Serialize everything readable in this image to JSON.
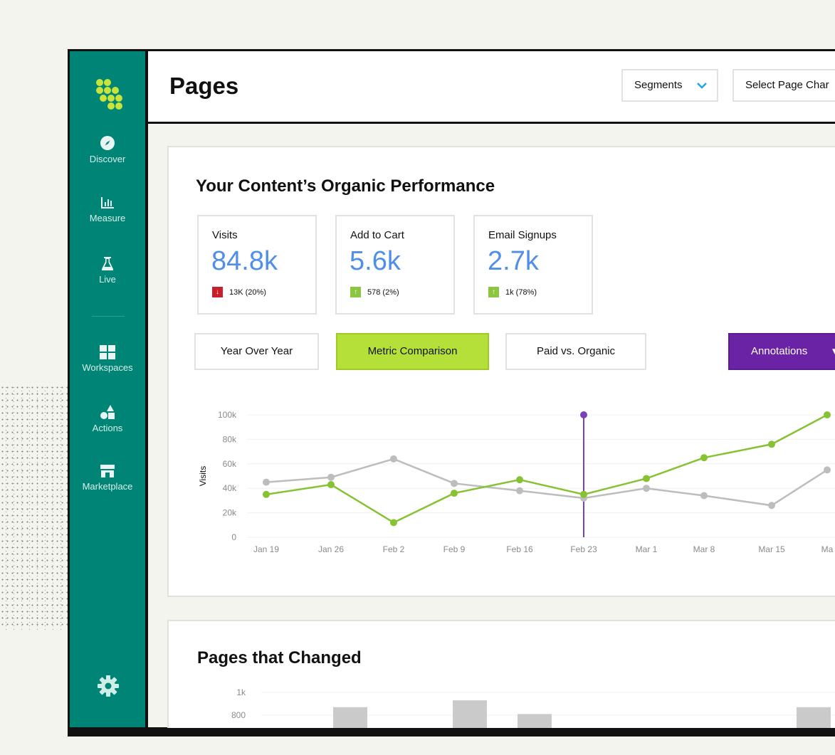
{
  "sidebar": {
    "items": [
      {
        "label": "Discover",
        "icon": "compass-icon"
      },
      {
        "label": "Measure",
        "icon": "bar-chart-icon"
      },
      {
        "label": "Live",
        "icon": "flask-icon"
      },
      {
        "label": "Workspaces",
        "icon": "grid-icon"
      },
      {
        "label": "Actions",
        "icon": "shapes-icon"
      },
      {
        "label": "Marketplace",
        "icon": "storefront-icon"
      }
    ],
    "settings_icon": "gear-icon"
  },
  "header": {
    "title": "Pages",
    "segments_label": "Segments",
    "select_label": "Select Page Char"
  },
  "performance": {
    "title": "Your Content’s Organic Performance",
    "metrics": [
      {
        "label": "Visits",
        "value": "84.8k",
        "delta": "13K (20%)",
        "direction": "down"
      },
      {
        "label": "Add to Cart",
        "value": "5.6k",
        "delta": "578 (2%)",
        "direction": "up"
      },
      {
        "label": "Email Signups",
        "value": "2.7k",
        "delta": "1k (78%)",
        "direction": "up"
      }
    ],
    "tabs": [
      "Year Over Year",
      "Metric Comparison",
      "Paid vs. Organic"
    ],
    "annotations_label": "Annotations"
  },
  "colors": {
    "green": "#86c232",
    "gray": "#bdbdbd",
    "purple": "#7b3fb8",
    "accent_blue": "#4f8fe8"
  },
  "chart_data": [
    {
      "type": "line",
      "ylabel": "Visits",
      "ylim": [
        0,
        100000
      ],
      "yticks": [
        "0",
        "20k",
        "40k",
        "60k",
        "80k",
        "100k"
      ],
      "categories": [
        "Jan 19",
        "Jan 26",
        "Feb 2",
        "Feb 9",
        "Feb 16",
        "Feb 23",
        "Mar 1",
        "Mar 8",
        "Mar 15",
        "Ma"
      ],
      "series": [
        {
          "color": "green",
          "values": [
            35000,
            43000,
            12000,
            36000,
            47000,
            35000,
            48000,
            65000,
            76000,
            100000
          ]
        },
        {
          "color": "gray",
          "values": [
            45000,
            49000,
            64000,
            44000,
            38000,
            32000,
            40000,
            34000,
            26000,
            55000
          ]
        }
      ],
      "marker_category": "Feb 23"
    },
    {
      "type": "bar",
      "title": "Pages that Changed",
      "yticks": [
        "800",
        "1k"
      ],
      "values": [
        870,
        930,
        810,
        870
      ]
    }
  ]
}
